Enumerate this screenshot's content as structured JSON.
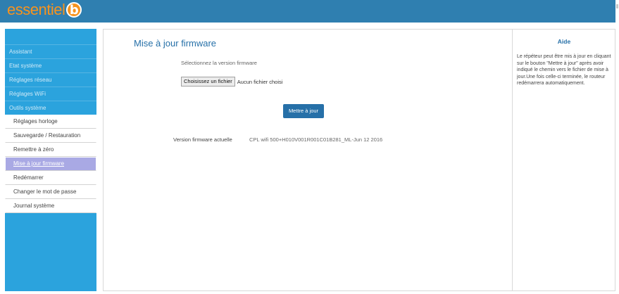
{
  "header": {
    "logo_text": "essentiel",
    "logo_badge": "b"
  },
  "sidebar": {
    "main_items": [
      {
        "label": "Assistant"
      },
      {
        "label": "Etat système"
      },
      {
        "label": "Réglages réseau"
      },
      {
        "label": "Réglages WiFi"
      },
      {
        "label": "Outils système"
      }
    ],
    "sub_items": [
      {
        "label": "Réglages horloge"
      },
      {
        "label": "Sauvegarde / Restauration"
      },
      {
        "label": "Remettre à zéro"
      },
      {
        "label": "Mise à jour firmware",
        "active": true
      },
      {
        "label": "Redémarrer"
      },
      {
        "label": "Changer le mot de passe"
      },
      {
        "label": "Journal système"
      }
    ]
  },
  "main": {
    "title": "Mise à jour firmware",
    "select_label": "Sélectionnez la version firmware",
    "file_button": "Choisissez un fichier",
    "file_status": "Aucun fichier choisi",
    "update_button": "Mettre à jour",
    "version_label": "Version firmware actuelle",
    "version_value": "CPL wifi 500+H010V001R001C01B281_ML-Jun 12 2016"
  },
  "help": {
    "title": "Aide",
    "text": "Le répéteur peut être mis à jour en cliquant sur le bouton \"Mettre à jour\" après avoir indiqué le chemin vers le fichier de mise à jour.Une fois celle-ci terminée, le routeur redémarrera automatiquement."
  },
  "colors": {
    "header_bg": "#2f7fb0",
    "sidebar_bg": "#2ba3dd",
    "accent": "#2670a8",
    "logo": "#f7931e",
    "active_item": "#a9a9e4"
  }
}
